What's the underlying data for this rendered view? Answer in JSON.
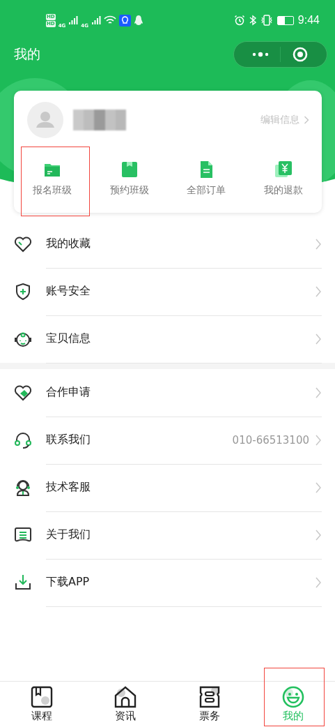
{
  "status_bar": {
    "sim_badges": [
      "HD",
      "HD"
    ],
    "network_labels": [
      "4G",
      "4G"
    ],
    "time": "9:44"
  },
  "header": {
    "title": "我的"
  },
  "profile": {
    "edit_link": "编辑信息"
  },
  "shortcuts": [
    {
      "label": "报名班级",
      "kind": "folder",
      "highlighted": true
    },
    {
      "label": "预约班级",
      "kind": "bookmark",
      "highlighted": false
    },
    {
      "label": "全部订单",
      "kind": "document",
      "highlighted": false
    },
    {
      "label": "我的退款",
      "kind": "refund",
      "highlighted": false
    }
  ],
  "menu_groups": [
    [
      {
        "label": "我的收藏",
        "kind": "heart"
      },
      {
        "label": "账号安全",
        "kind": "shield"
      },
      {
        "label": "宝贝信息",
        "kind": "baby"
      }
    ],
    [
      {
        "label": "合作申请",
        "kind": "handshake"
      },
      {
        "label": "联系我们",
        "kind": "headset",
        "value": "010-66513100"
      },
      {
        "label": "技术客服",
        "kind": "agent"
      },
      {
        "label": "关于我们",
        "kind": "list"
      },
      {
        "label": "下载APP",
        "kind": "download"
      }
    ]
  ],
  "tab_bar": [
    {
      "label": "课程",
      "kind": "book",
      "selected": false,
      "highlighted": false
    },
    {
      "label": "资讯",
      "kind": "house",
      "selected": false,
      "highlighted": false
    },
    {
      "label": "票务",
      "kind": "ticket",
      "selected": false,
      "highlighted": false
    },
    {
      "label": "我的",
      "kind": "smile",
      "selected": true,
      "highlighted": true
    }
  ]
}
